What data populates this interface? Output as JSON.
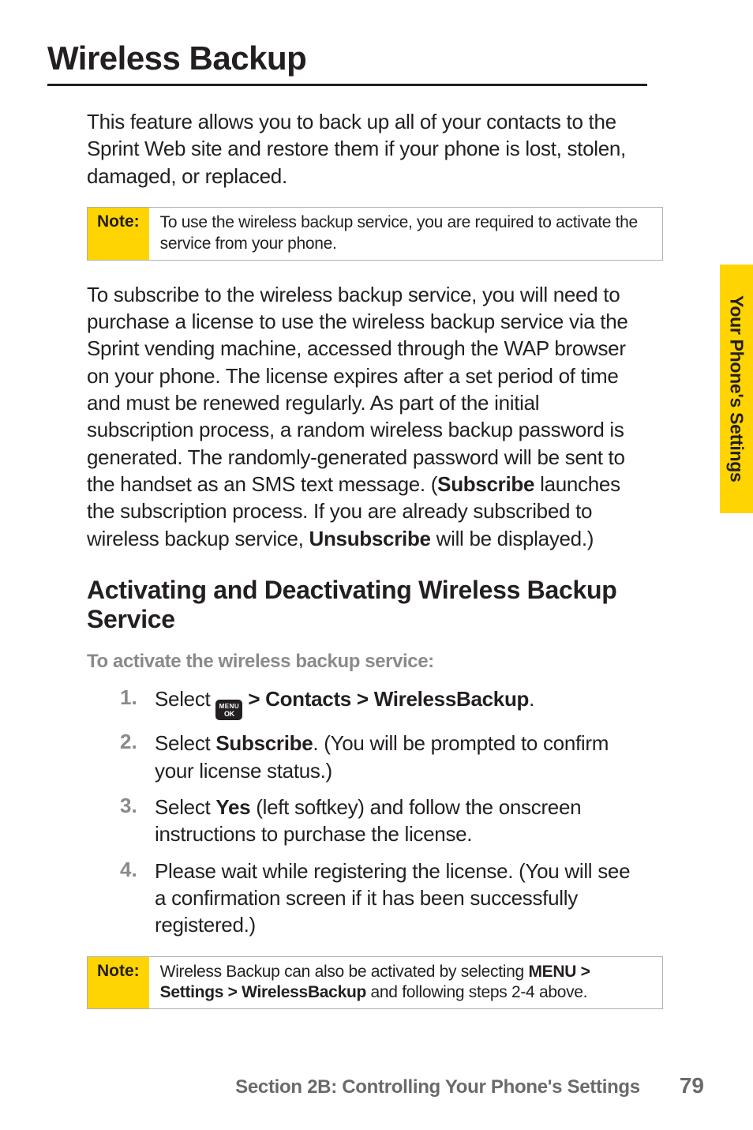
{
  "title": "Wireless Backup",
  "intro": "This feature allows you to back up all of your contacts to the Sprint Web site and restore them if your phone is lost, stolen, damaged, or replaced.",
  "note1": {
    "label": "Note:",
    "text": "To use the wireless backup service, you are required to activate the service from your phone."
  },
  "longpara": {
    "p1": "To subscribe to the wireless backup service, you will need to purchase a license to use the wireless backup service via the Sprint vending machine, accessed through the WAP browser on your phone. The license expires after a set period of time and must be renewed regularly. As part of the initial subscription process, a random wireless backup password is generated. The randomly-generated password will be sent to the handset as an SMS text message. (",
    "b1": "Subscribe",
    "p2": " launches the subscription process. If you are already subscribed to wireless backup service, ",
    "b2": "Unsubscribe",
    "p3": " will be displayed.)"
  },
  "heading2": "Activating and Deactivating Wireless Backup Service",
  "subheading": "To activate the wireless backup service:",
  "steps": {
    "s1": {
      "n": "1.",
      "pre": "Select ",
      "post": " > Contacts > WirelessBackup",
      "end": "."
    },
    "s2": {
      "n": "2.",
      "a": "Select ",
      "b": "Subscribe",
      "c": ". (You will be prompted to confirm your license status.)"
    },
    "s3": {
      "n": "3.",
      "a": " Select ",
      "b": "Yes",
      "c": " (left softkey) and follow the onscreen instructions to purchase the license."
    },
    "s4": {
      "n": "4.",
      "a": " Please wait while registering the license. (You will see a confirmation screen if it has been successfully registered.)"
    }
  },
  "note2": {
    "label": "Note:",
    "a": "Wireless Backup can also be activated by selecting ",
    "b": "MENU > Settings > WirelessBackup",
    "c": " and following steps 2-4 above."
  },
  "sidetab": "Your Phone's Settings",
  "footer": {
    "section": "Section 2B: Controlling Your Phone's Settings",
    "page": "79"
  },
  "menu_icon": {
    "l1": "MENU",
    "l2": "OK"
  }
}
